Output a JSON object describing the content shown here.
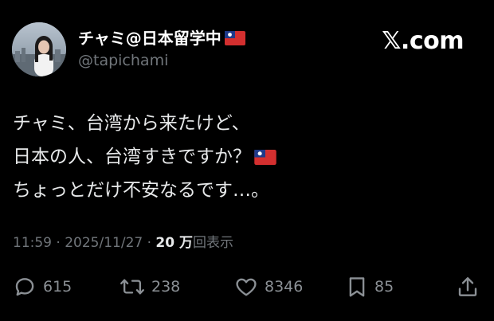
{
  "author": {
    "display_name": "チャミ@日本留学中",
    "handle": "@tapichami",
    "flag_icon": "taiwan-flag-icon"
  },
  "brand": {
    "logo_text": "𝕏.com"
  },
  "tweet": {
    "lines": [
      "チャミ、台湾から来たけど、",
      "日本の人、台湾すきですか？",
      "ちょっとだけ不安なるです…。"
    ]
  },
  "meta": {
    "time": "11:59",
    "separator": " · ",
    "date": "2025/11/27",
    "views_count": "20 万",
    "views_label": "回表示"
  },
  "actions": {
    "replies": "615",
    "retweets": "238",
    "likes": "8346",
    "bookmarks": "85"
  },
  "colors": {
    "background": "#000000",
    "text": "#e7e9ea",
    "muted": "#71767b",
    "flag_red": "#d32f2f",
    "flag_blue": "#1e3a8a"
  }
}
